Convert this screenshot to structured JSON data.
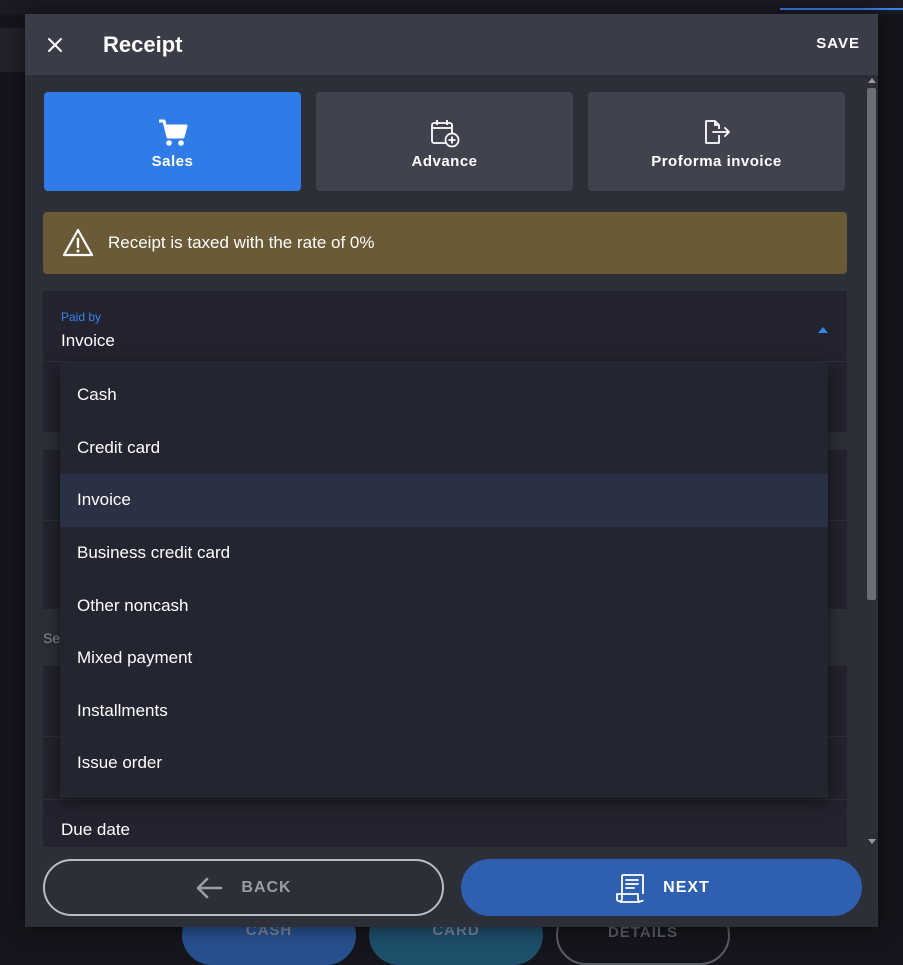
{
  "background": {
    "buttons": {
      "cash": "CASH",
      "card": "CARD",
      "details": "DETAILS"
    }
  },
  "dialog": {
    "title": "Receipt",
    "save_label": "SAVE",
    "receipt_types": [
      {
        "label": "Sales",
        "icon": "cart-icon",
        "active": true
      },
      {
        "label": "Advance",
        "icon": "calendar-plus-icon",
        "active": false
      },
      {
        "label": "Proforma invoice",
        "icon": "document-export-icon",
        "active": false
      }
    ],
    "warning": "Receipt is taxed with the rate of 0%",
    "paid_by": {
      "label": "Paid by",
      "value": "Invoice",
      "options": [
        "Cash",
        "Credit card",
        "Invoice",
        "Business credit card",
        "Other noncash",
        "Mixed payment",
        "Installments",
        "Issue order"
      ],
      "selected": "Invoice"
    },
    "section_label": "Se",
    "due_date_label": "Due date",
    "footer": {
      "back_label": "BACK",
      "next_label": "NEXT"
    }
  },
  "colors": {
    "accent": "#2f7ce8",
    "warning": "#6b5a36",
    "next": "#2f5fb0"
  }
}
